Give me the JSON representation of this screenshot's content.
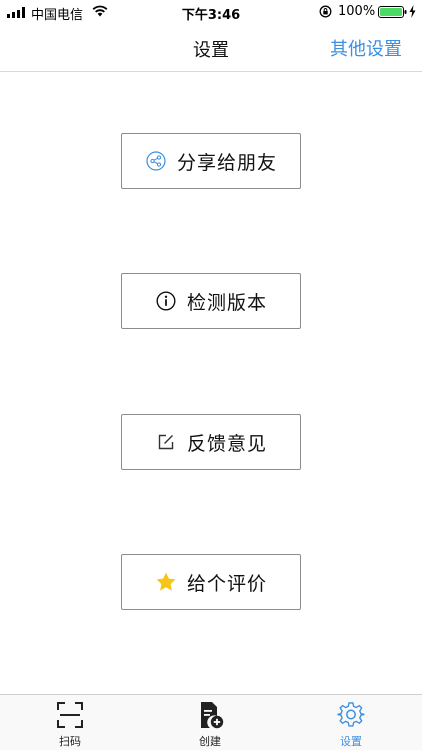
{
  "status_bar": {
    "carrier": "中国电信",
    "time": "下午3:46",
    "battery_percent": "100%"
  },
  "nav": {
    "title": "设置",
    "right_button": "其他设置"
  },
  "actions": [
    {
      "label": "分享给朋友",
      "icon": "share-icon"
    },
    {
      "label": "检测版本",
      "icon": "info-icon"
    },
    {
      "label": "反馈意见",
      "icon": "edit-icon"
    },
    {
      "label": "给个评价",
      "icon": "star-icon"
    }
  ],
  "tabs": [
    {
      "label": "扫码",
      "icon": "scan-icon",
      "active": false
    },
    {
      "label": "创建",
      "icon": "create-document-icon",
      "active": false
    },
    {
      "label": "设置",
      "icon": "gear-icon",
      "active": true
    }
  ],
  "colors": {
    "accent": "#3b8fe0",
    "star": "#f5c518",
    "border": "#8c8c8c"
  }
}
